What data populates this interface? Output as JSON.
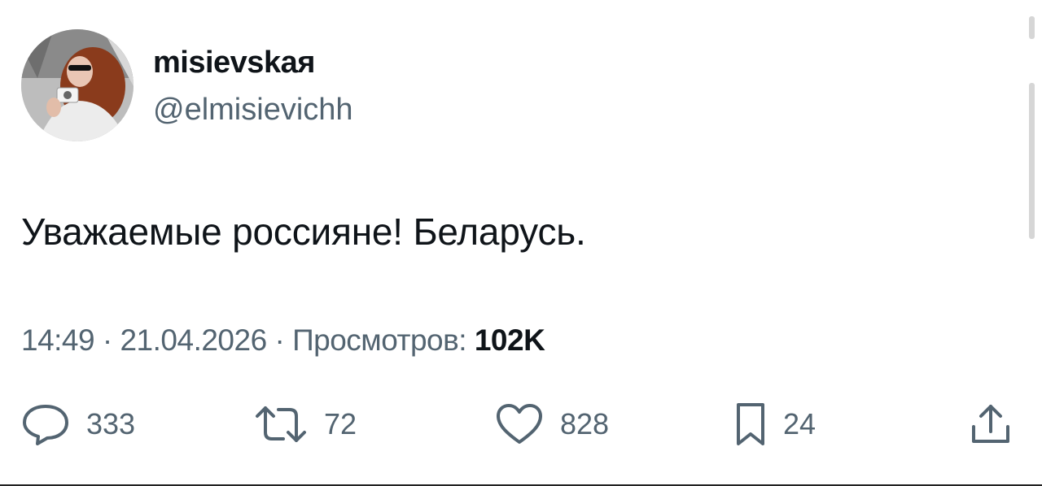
{
  "author": {
    "name": "misievskaя",
    "handle": "@elmisievichh"
  },
  "tweet": {
    "text": "Уважаемые россияне! Беларусь."
  },
  "meta": {
    "time": "14:49",
    "separator": "·",
    "date": "21.04.2026",
    "views_label": "Просмотров:",
    "views_count": "102K"
  },
  "actions": {
    "replies": "333",
    "retweets": "72",
    "likes": "828",
    "bookmarks": "24"
  },
  "icons": {
    "reply": "speech-bubble-icon",
    "retweet": "retweet-icon",
    "like": "heart-icon",
    "bookmark": "bookmark-icon",
    "share": "share-icon"
  },
  "colors": {
    "text_primary": "#0f1419",
    "text_secondary": "#536471",
    "background": "#ffffff"
  }
}
